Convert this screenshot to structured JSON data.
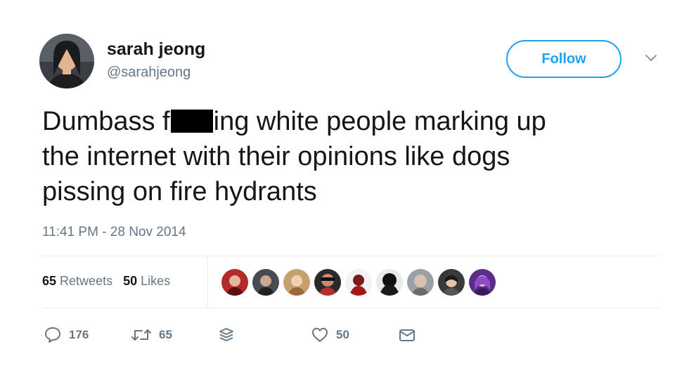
{
  "author": {
    "display_name": "sarah jeong",
    "handle": "@sarahjeong"
  },
  "follow_label": "Follow",
  "tweet": {
    "line1_before": "Dumbass f",
    "line1_after": "ing white people marking up",
    "line2": "the internet with their opinions like dogs",
    "line3": "pissing on fire hydrants"
  },
  "timestamp": "11:41 PM - 28 Nov 2014",
  "stats": {
    "retweets_count": "65",
    "retweets_label": "Retweets",
    "likes_count": "50",
    "likes_label": "Likes"
  },
  "actions": {
    "reply_count": "176",
    "retweet_count": "65",
    "like_count": "50"
  },
  "icons": {
    "reply": "reply-icon",
    "retweet": "retweet-icon",
    "stack": "layers-icon",
    "like": "heart-icon",
    "dm": "envelope-icon",
    "caret": "chevron-down-icon"
  },
  "colors": {
    "accent": "#1da1f2",
    "text": "#14171a",
    "muted": "#657786"
  }
}
